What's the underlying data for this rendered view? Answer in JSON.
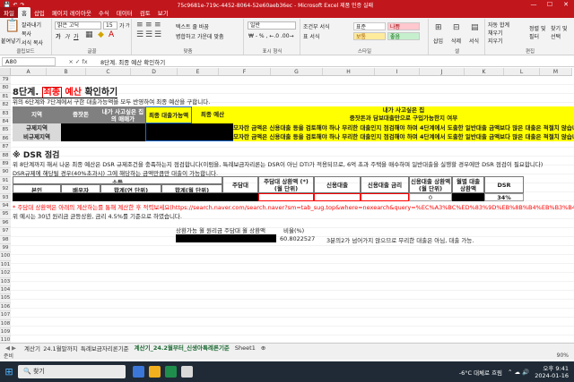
{
  "window": {
    "title": "75c9681e-719c-4452-8064-52e60aeb36ec - Microsoft Excel 제품 인증 실패",
    "quick_access": [
      "💾",
      "↶",
      "↷"
    ],
    "controls": [
      "—",
      "☐",
      "✕"
    ]
  },
  "menu": {
    "tabs": [
      "파일",
      "홈",
      "삽입",
      "페이지 레이아웃",
      "수식",
      "데이터",
      "검토",
      "보기"
    ],
    "active": "홈"
  },
  "ribbon": {
    "clipboard": {
      "paste": "붙여넣기",
      "cut": "잘라내기",
      "copy": "복사",
      "format_painter": "서식 복사",
      "label": "클립보드"
    },
    "font": {
      "name": "맑은 고딕",
      "size": "15",
      "label": "글꼴",
      "bold": "가",
      "italic": "가",
      "underline": "가",
      "grow": "가",
      "shrink": "가"
    },
    "alignment": {
      "wrap": "텍스트 줄 바꿈",
      "merge": "병합하고 가운데 맞춤",
      "label": "맞춤"
    },
    "number": {
      "format": "일반",
      "label": "표시 형식"
    },
    "styles": {
      "conditional": "조건부 서식",
      "table": "표 서식",
      "label": "스타일",
      "chips": [
        {
          "text": "표준",
          "bg": "#ffffff",
          "fg": "#222222"
        },
        {
          "text": "나쁨",
          "bg": "#ffc7ce",
          "fg": "#9c0006"
        },
        {
          "text": "보통",
          "bg": "#ffeb9c",
          "fg": "#9c5700"
        },
        {
          "text": "좋음",
          "bg": "#c6efce",
          "fg": "#006100"
        }
      ]
    },
    "cells": {
      "insert": "삽입",
      "delete": "삭제",
      "format": "서식",
      "label": "셀"
    },
    "editing": {
      "autosum": "자동 합계",
      "fill": "채우기",
      "clear": "지우기",
      "sort": "정렬 및 필터",
      "find": "찾기 및 선택",
      "label": "편집"
    }
  },
  "formula_bar": {
    "name_box": "A80",
    "fx": "×  ✓  fx",
    "content": "8단계. 최종 예산 확인하기"
  },
  "columns": [
    "A",
    "B",
    "C",
    "D",
    "E",
    "F",
    "G",
    "H",
    "I",
    "J",
    "K",
    "L",
    "M"
  ],
  "rows": [
    "79",
    "80",
    "81",
    "82",
    "83",
    "84",
    "85",
    "86",
    "87",
    "88",
    "89",
    "90",
    "91",
    "92",
    "93",
    "94",
    "95",
    "96",
    "97",
    "98",
    "99",
    "100",
    "101",
    "102",
    "103",
    "104",
    "105",
    "106",
    "107",
    "108",
    "109",
    "110"
  ],
  "sheet": {
    "title_prefix": "8단계.",
    "title_highlight": "최종",
    "title_highlight2": "예산",
    "title_suffix": "확인하기",
    "desc": "위의 6단계와 7단계에서 구한 대출가능액을 모두 반영하여 최종 예산을 구합니다.",
    "t1": {
      "h_region": "지역",
      "h_own": "중잣돈",
      "h_price": "내가 사고싶은 집의 매매가",
      "h_loan": "최종 대출가능액",
      "h_budget": "최종 예산",
      "h_note_title": "내가 사고싶은 집",
      "h_note_sub": "중잣돈과 담보대출만으로 구입가능한지 여부",
      "r1_label": "규제지역",
      "r2_label": "비규제지역",
      "r1_note": "모자란 금액은 신용대출 등을 검토해야 하나 무리한 대출인지 점검해야 하며 4단계에서 도출한 일반대출 금액보다 많은 대출은 적절치 않습니다",
      "r2_note": "모자란 금액은 신용대출 등을 검토해야 하나 무리한 대출인지 점검해야 하며 4단계에서 도출한 일반대출 금액보다 많은 대출은 적절치 않습니다"
    },
    "dsr_title": "※ DSR 점검",
    "dsr_desc1": "위 8단계까지 해서 나온 최종 예산은 DSR 규제조건을 충족하는지 점검합니다(이럼을, 특례보금자리론는 DSR이 아닌 DTI가 적용되므로, 6억 초과 주택을 매수하며 일반대출을 실행할 경우에만 DSR 점검이 필요합니다)",
    "dsr_desc2": "DSR규제에 해당될 경우(40%초과시) 그에 해당하는 금액만큼만 대출이 가능합니다.",
    "t2": {
      "h_income": "소득",
      "h_self": "본인",
      "h_spouse": "배우자",
      "h_sum_year": "합계(연 단위)",
      "h_sum_month": "합계(월 단위)",
      "h_mortgage": "주담대",
      "h_mortgage_pay": "주담대 상환액 (*) (월 단위)",
      "h_credit": "신용대출",
      "h_credit_rate": "신용대출 금리",
      "h_credit_pay": "신용대출 상환액 (월 단위)",
      "h_month_pay": "월별 대출 상환액",
      "h_dsr": "DSR",
      "zero": "0",
      "dsr_value": "34%"
    },
    "note_red": "* 주담대 상환액은 아래의 계산하는를 통해 계산한 후 적력보세요(https://search.naver.com/search.naver?sm=tab_sug.top&where=nexearch&query=%EC%A3%BC%ED%83%9D%EB%8B%B4%EB%B3%B4%EB%8C%80%EC%B6%9C+%EA%B3%84",
    "note2": "위 예시는 30년 원리금 균등상환, 금리 4.5%를 기준으로 하였습니다.",
    "calc_label": "상환가능 월 원리금 주담대 월 상환액",
    "ratio_label": "비율(%)",
    "ratio_value": "60.8022527",
    "ratio_comment": "3분의2가 넘어가지 않으므로 무리한 대출은 아님, 대출 가능."
  },
  "sheet_tabs": [
    "계산기_24.1월말까지_특례보금자리론기준",
    "계산기_24.2월부터_신생아특례론기준",
    "Sheet1"
  ],
  "status": {
    "ready": "준비",
    "zoom": "90%"
  },
  "taskbar": {
    "search": "찾기",
    "weather": "-6°C 대체로 흐림",
    "time": "오후 9:41",
    "date": "2024-01-16"
  },
  "colors": {
    "brand": "#c0161c",
    "yellow": "#ffff00",
    "black": "#000000",
    "grey": "#808080",
    "red_text": "#ff0000",
    "blue_border": "#1f6cd1"
  }
}
